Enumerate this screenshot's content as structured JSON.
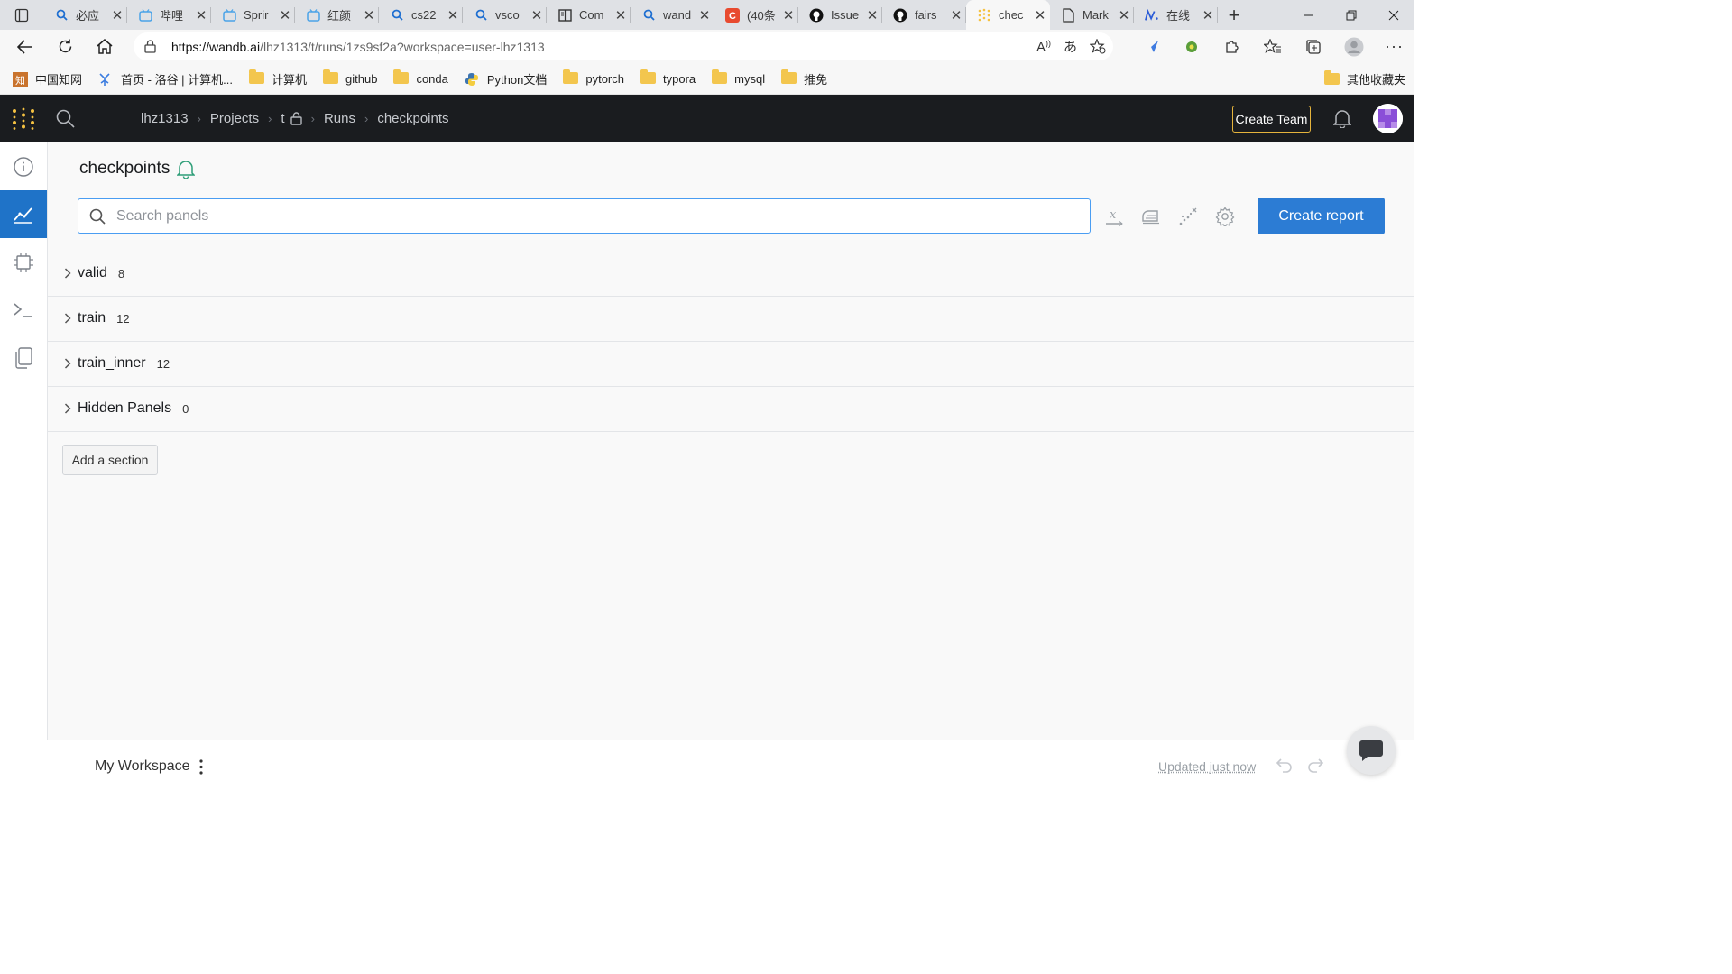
{
  "browser": {
    "tabs": [
      {
        "title": "必应",
        "icon": "search-icon"
      },
      {
        "title": "哔哩",
        "icon": "bilibili-icon"
      },
      {
        "title": "Sprir",
        "icon": "bilibili-icon"
      },
      {
        "title": "红颜",
        "icon": "bilibili-icon"
      },
      {
        "title": "cs22",
        "icon": "search-icon"
      },
      {
        "title": "vsco",
        "icon": "search-icon"
      },
      {
        "title": "Com",
        "icon": "book-icon"
      },
      {
        "title": "wand",
        "icon": "search-icon"
      },
      {
        "title": "(40条",
        "icon": "csdn-icon"
      },
      {
        "title": "Issue",
        "icon": "github-icon"
      },
      {
        "title": "fairs",
        "icon": "github-icon"
      },
      {
        "title": "chec",
        "icon": "wandb-icon"
      },
      {
        "title": "Mark",
        "icon": "document-icon"
      },
      {
        "title": "在线",
        "icon": "n-logo-icon"
      }
    ],
    "active_tab_index": 11,
    "url_host": "https://wandb.ai",
    "url_path": "/lhz1313/t/runs/1zs9sf2a?workspace=user-lhz1313",
    "bookmarks": [
      {
        "label": "中国知网",
        "icon": "cnki-icon"
      },
      {
        "label": "首页 - 洛谷 | 计算机...",
        "icon": "luogu-icon"
      },
      {
        "label": "计算机",
        "icon": "folder-icon"
      },
      {
        "label": "github",
        "icon": "folder-icon"
      },
      {
        "label": "conda",
        "icon": "folder-icon"
      },
      {
        "label": "Python文档",
        "icon": "python-icon"
      },
      {
        "label": "pytorch",
        "icon": "folder-icon"
      },
      {
        "label": "typora",
        "icon": "folder-icon"
      },
      {
        "label": "mysql",
        "icon": "folder-icon"
      },
      {
        "label": "推免",
        "icon": "folder-icon"
      }
    ],
    "other_bookmarks": "其他收藏夹"
  },
  "header": {
    "breadcrumbs": {
      "user": "lhz1313",
      "projects": "Projects",
      "project": "t",
      "runs": "Runs",
      "run": "checkpoints"
    },
    "create_team": "Create Team"
  },
  "colors": {
    "accent": "#2c7cd4",
    "header_bg": "#1a1c1f",
    "create_team_border": "#e5b43c",
    "logo": "#f5c242"
  },
  "main": {
    "title": "checkpoints",
    "search_placeholder": "Search panels",
    "create_report": "Create report",
    "sections": [
      {
        "name": "valid",
        "count": "8"
      },
      {
        "name": "train",
        "count": "12"
      },
      {
        "name": "train_inner",
        "count": "12"
      },
      {
        "name": "Hidden Panels",
        "count": "0"
      }
    ],
    "add_section": "Add a section"
  },
  "footer": {
    "workspace": "My Workspace",
    "updated": "Updated just now"
  }
}
